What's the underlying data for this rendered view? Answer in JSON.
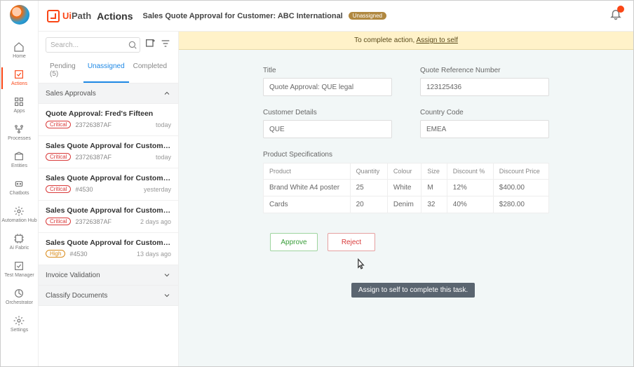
{
  "rail": {
    "items": [
      {
        "id": "home",
        "label": "Home"
      },
      {
        "id": "actions",
        "label": "Actions"
      },
      {
        "id": "apps",
        "label": "Apps"
      },
      {
        "id": "processes",
        "label": "Processes"
      },
      {
        "id": "entities",
        "label": "Entities"
      },
      {
        "id": "chatbots",
        "label": "Chatbots"
      },
      {
        "id": "automation-hub",
        "label": "Automation Hub"
      },
      {
        "id": "ai-fabric",
        "label": "Ai Fabric"
      },
      {
        "id": "test-manager",
        "label": "Test Manager"
      },
      {
        "id": "orchestrator",
        "label": "Orchestrator"
      },
      {
        "id": "settings",
        "label": "Settings"
      }
    ],
    "active": 1
  },
  "header": {
    "brand_ui": "Ui",
    "brand_path": "Path",
    "brand_sub": "Actions",
    "title": "Sales Quote Approval for Customer: ABC International",
    "status_pill": "Unassigned"
  },
  "search": {
    "placeholder": "Search..."
  },
  "tabs": [
    {
      "label": "Pending (5)"
    },
    {
      "label": "Unassigned"
    },
    {
      "label": "Completed"
    }
  ],
  "tabs_active": 1,
  "sections": [
    {
      "label": "Sales Approvals",
      "open": true
    },
    {
      "label": "Invoice Validation",
      "open": false
    },
    {
      "label": "Classify Documents",
      "open": false
    }
  ],
  "actions": [
    {
      "title": "Quote Approval: Fred's Fifteen",
      "priority": "Critical",
      "ref": "23726387AF",
      "time": "today"
    },
    {
      "title": "Sales Quote Approval for Customer ABC",
      "priority": "Critical",
      "ref": "23726387AF",
      "time": "today"
    },
    {
      "title": "Sales Quote Approval for Customer ABC",
      "priority": "Critical",
      "ref": "#4530",
      "time": "yesterday"
    },
    {
      "title": "Sales Quote Approval for Customer ABC",
      "priority": "Critical",
      "ref": "23726387AF",
      "time": "2 days ago"
    },
    {
      "title": "Sales Quote Approval for Customer ABC",
      "priority": "High",
      "ref": "#4530",
      "time": "13 days ago"
    }
  ],
  "banner": {
    "prefix": "To complete action, ",
    "link": "Assign to self"
  },
  "form": {
    "fields": {
      "title_label": "Title",
      "title_value": "Quote Approval: QUE legal",
      "ref_label": "Quote Reference Number",
      "ref_value": "123125436",
      "cust_label": "Customer Details",
      "cust_value": "QUE",
      "country_label": "Country Code",
      "country_value": "EMEA"
    },
    "spec_label": "Product Specifications",
    "table": {
      "headers": [
        "Product",
        "Quantity",
        "Colour",
        "Size",
        "Discount %",
        "Discount Price"
      ],
      "rows": [
        [
          "Brand White A4 poster",
          "25",
          "White",
          "M",
          "12%",
          "$400.00"
        ],
        [
          "Cards",
          "20",
          "Denim",
          "32",
          "40%",
          "$280.00"
        ]
      ]
    },
    "buttons": {
      "approve": "Approve",
      "reject": "Reject"
    }
  },
  "tooltip": "Assign to self to complete this task."
}
